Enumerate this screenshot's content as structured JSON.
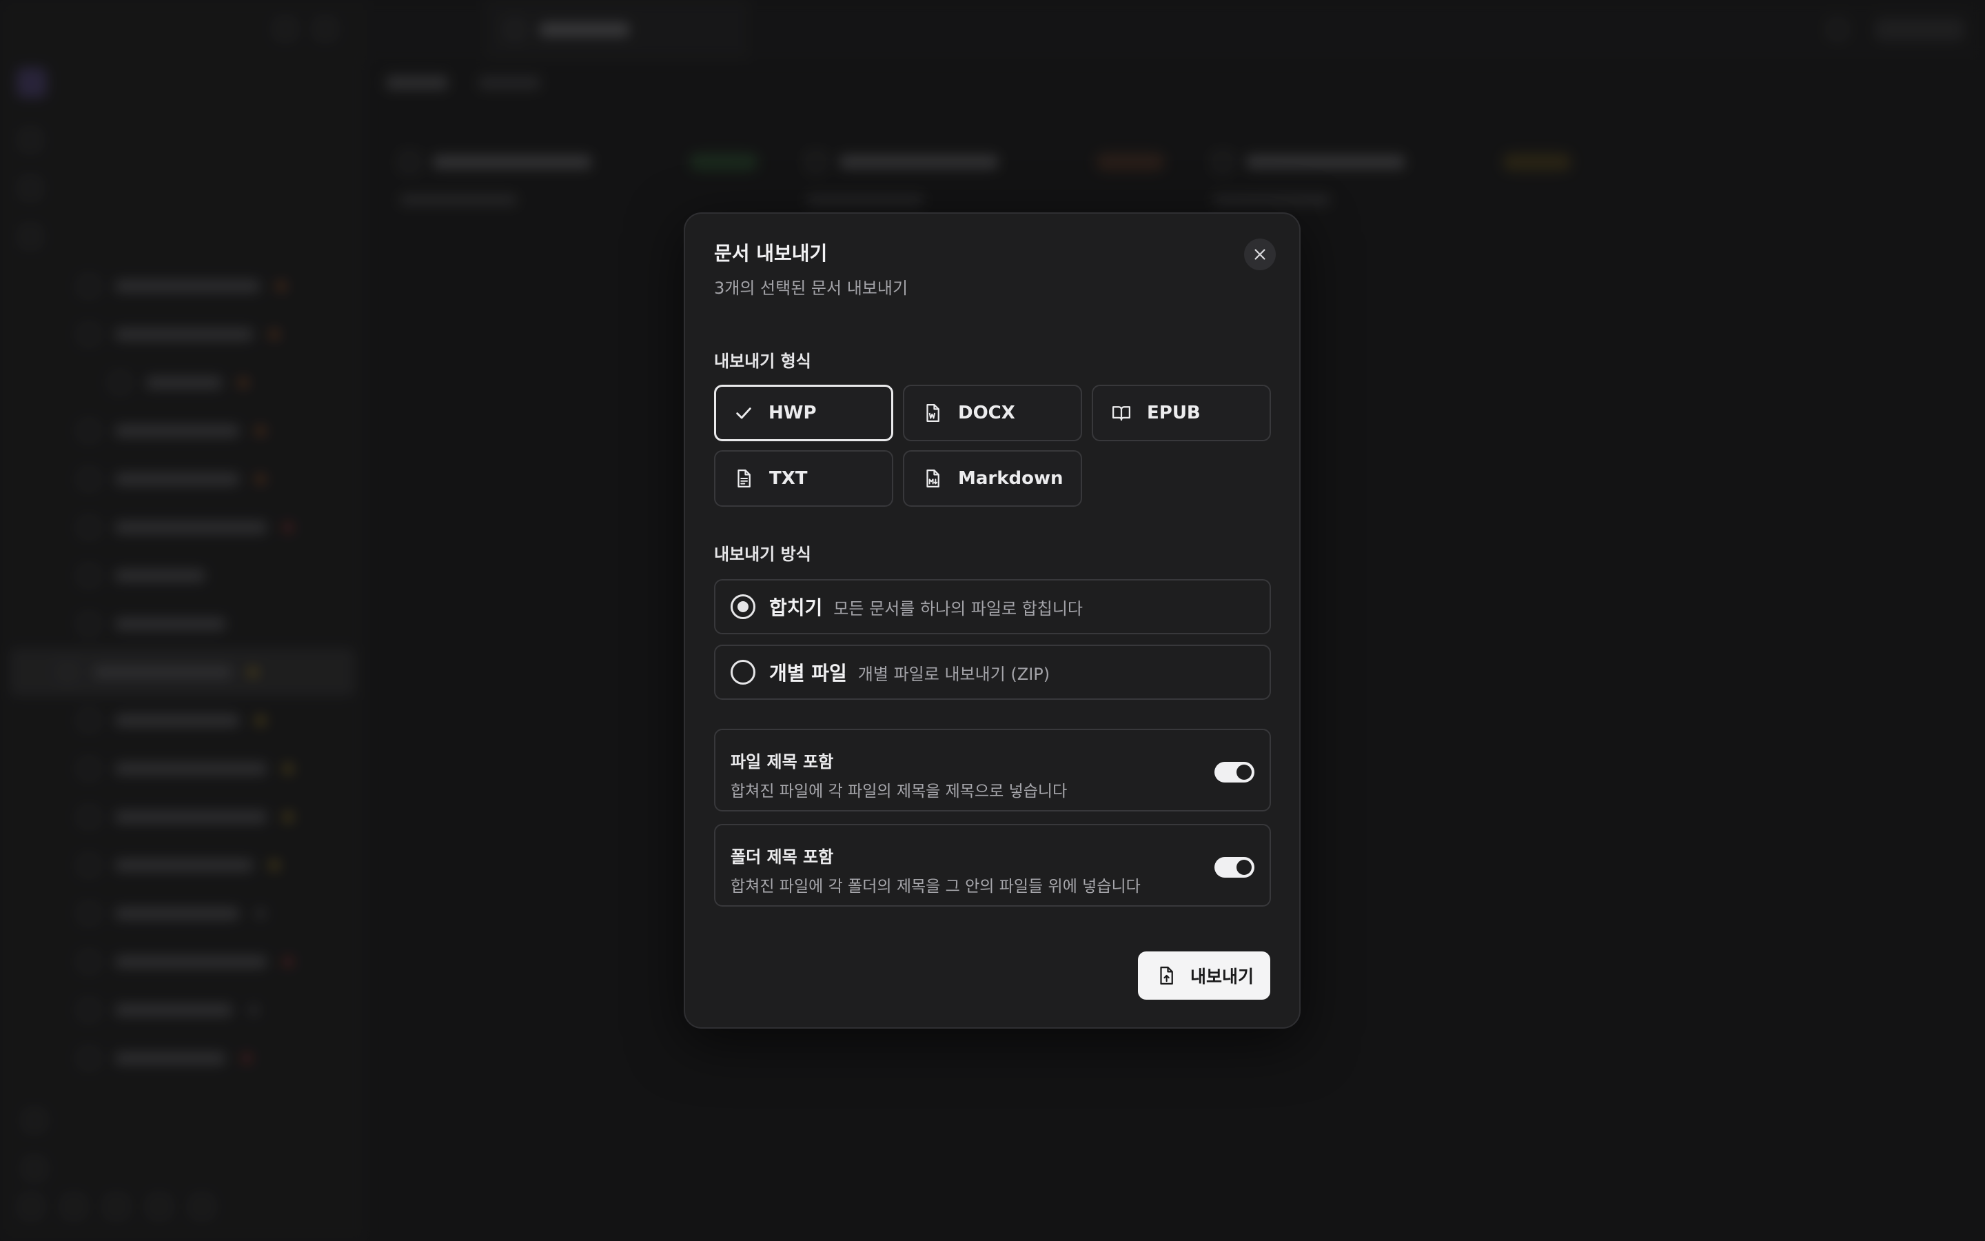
{
  "dialog": {
    "title": "문서 내보내기",
    "subtitle": "3개의 선택된 문서 내보내기",
    "format_label": "내보내기 형식",
    "formats": [
      {
        "label": "HWP",
        "icon": "check-icon",
        "selected": true
      },
      {
        "label": "DOCX",
        "icon": "word-file-icon",
        "selected": false
      },
      {
        "label": "EPUB",
        "icon": "book-open-icon",
        "selected": false
      },
      {
        "label": "TXT",
        "icon": "text-file-icon",
        "selected": false
      },
      {
        "label": "Markdown",
        "icon": "markdown-file-icon",
        "selected": false
      }
    ],
    "method_label": "내보내기 방식",
    "methods": [
      {
        "title": "합치기",
        "desc": "모든 문서를 하나의 파일로 합칩니다",
        "selected": true
      },
      {
        "title": "개별 파일",
        "desc": "개별 파일로 내보내기 (ZIP)",
        "selected": false
      }
    ],
    "toggles": [
      {
        "title": "파일 제목 포함",
        "desc": "합쳐진 파일에 각 파일의 제목을 제목으로 넣습니다",
        "on": true
      },
      {
        "title": "폴더 제목 포함",
        "desc": "합쳐진 파일에 각 폴더의 제목을 그 안의 파일들 위에 넣습니다",
        "on": true
      }
    ],
    "export_label": "내보내기"
  }
}
